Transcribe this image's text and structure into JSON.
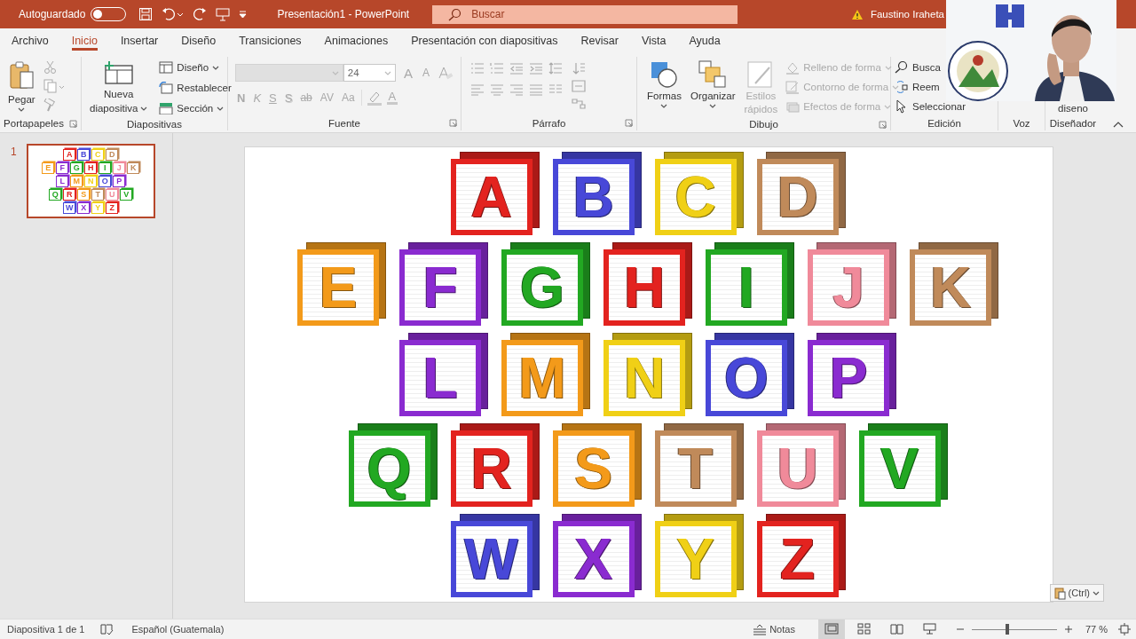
{
  "title_bar": {
    "autosave": {
      "label": "Autoguardado",
      "on": false
    },
    "title": "Presentación1  -  PowerPoint",
    "search": {
      "placeholder": "Buscar"
    },
    "user": "Faustino Iraheta"
  },
  "tabs": [
    {
      "label": "Archivo",
      "selected": false
    },
    {
      "label": "Inicio",
      "selected": true
    },
    {
      "label": "Insertar",
      "selected": false
    },
    {
      "label": "Diseño",
      "selected": false
    },
    {
      "label": "Transiciones",
      "selected": false
    },
    {
      "label": "Animaciones",
      "selected": false
    },
    {
      "label": "Presentación con diapositivas",
      "selected": false
    },
    {
      "label": "Revisar",
      "selected": false
    },
    {
      "label": "Vista",
      "selected": false
    },
    {
      "label": "Ayuda",
      "selected": false
    }
  ],
  "ribbon": {
    "clipboard": {
      "paste": "Pegar",
      "label": "Portapapeles"
    },
    "slides": {
      "new_slide": [
        "Nueva",
        "diapositiva"
      ],
      "items": [
        {
          "label": "Diseño",
          "kind": "layout"
        },
        {
          "label": "Restablecer",
          "kind": "reset"
        },
        {
          "label": "Sección",
          "kind": "section"
        }
      ],
      "label": "Diapositivas"
    },
    "font": {
      "disabled": true,
      "size": "24",
      "row1": [
        {
          "text": "A",
          "kind": "grow"
        },
        {
          "text": "A",
          "kind": "shrink"
        }
      ],
      "row2": [
        {
          "text": "N",
          "kind": "bold"
        },
        {
          "text": "K",
          "kind": "italic"
        },
        {
          "text": "S",
          "kind": "underline"
        },
        {
          "text": "S",
          "kind": "shadow"
        },
        {
          "text": "ab",
          "kind": "strike"
        },
        {
          "text": "AV",
          "kind": "spacing"
        },
        {
          "text": "Aa",
          "kind": "case"
        },
        {
          "text": "A",
          "kind": "color"
        }
      ],
      "label": "Fuente"
    },
    "paragraph": {
      "disabled": true,
      "label": "Párrafo"
    },
    "drawing": {
      "shapes": "Formas",
      "arrange": "Organizar",
      "quick_styles": {
        "label": "Estilos rápidos",
        "disabled": true
      },
      "format_items": [
        {
          "label": "Relleno de forma",
          "kind": "fill",
          "disabled": true
        },
        {
          "label": "Contorno de forma",
          "kind": "outline",
          "disabled": true
        },
        {
          "label": "Efectos de forma",
          "kind": "effects",
          "disabled": true
        }
      ],
      "label": "Dibujo"
    },
    "editing": {
      "items": [
        {
          "label": "Busca",
          "kind": "find"
        },
        {
          "label": "Reem",
          "kind": "replace"
        },
        {
          "label": "Seleccionar",
          "kind": "select"
        }
      ],
      "label": "Edición"
    },
    "voice": {
      "label": "Voz"
    },
    "designer": {
      "button": "diseno",
      "label": "Diseñador"
    }
  },
  "thumbnails": [
    {
      "number": "1",
      "selected": true,
      "rows": [
        [
          "A",
          "B",
          "C",
          "D"
        ],
        [
          "E",
          "F",
          "G",
          "H",
          "I",
          "J",
          "K"
        ],
        [
          "L",
          "M",
          "N",
          "O",
          "P"
        ],
        [
          "Q",
          "R",
          "S",
          "T",
          "U",
          "V"
        ],
        [
          "W",
          "X",
          "Y",
          "Z"
        ]
      ]
    }
  ],
  "slide": {
    "rows": [
      {
        "blocks": [
          {
            "letter": "A",
            "color": "#e3231f"
          },
          {
            "letter": "B",
            "color": "#4848d8"
          },
          {
            "letter": "C",
            "color": "#f0d016"
          },
          {
            "letter": "D",
            "color": "#c08a5a"
          }
        ]
      },
      {
        "blocks": [
          {
            "letter": "E",
            "color": "#f39a1a"
          },
          {
            "letter": "F",
            "color": "#8a2bd0"
          },
          {
            "letter": "G",
            "color": "#22a822"
          },
          {
            "letter": "H",
            "color": "#e3231f"
          },
          {
            "letter": "I",
            "color": "#22a822"
          },
          {
            "letter": "J",
            "color": "#f08a9a"
          },
          {
            "letter": "K",
            "color": "#c08a5a"
          }
        ]
      },
      {
        "blocks": [
          {
            "letter": "L",
            "color": "#8a2bd0"
          },
          {
            "letter": "M",
            "color": "#f39a1a"
          },
          {
            "letter": "N",
            "color": "#f0d016"
          },
          {
            "letter": "O",
            "color": "#4848d8"
          },
          {
            "letter": "P",
            "color": "#8a2bd0"
          }
        ]
      },
      {
        "blocks": [
          {
            "letter": "Q",
            "color": "#22a822"
          },
          {
            "letter": "R",
            "color": "#e3231f"
          },
          {
            "letter": "S",
            "color": "#f39a1a"
          },
          {
            "letter": "T",
            "color": "#c08a5a"
          },
          {
            "letter": "U",
            "color": "#f08a9a"
          },
          {
            "letter": "V",
            "color": "#22a822"
          }
        ]
      },
      {
        "blocks": [
          {
            "letter": "W",
            "color": "#4848d8"
          },
          {
            "letter": "X",
            "color": "#8a2bd0"
          },
          {
            "letter": "Y",
            "color": "#f0d016"
          },
          {
            "letter": "Z",
            "color": "#e3231f"
          }
        ]
      }
    ]
  },
  "paste_options": "(Ctrl)",
  "status_bar": {
    "slide_count": "Diapositiva 1 de 1",
    "language": "Español (Guatemala)",
    "notes": "Notas",
    "views": [
      {
        "kind": "normal",
        "selected": true
      },
      {
        "kind": "sorter",
        "selected": false
      },
      {
        "kind": "reading",
        "selected": false
      },
      {
        "kind": "show",
        "selected": false
      }
    ],
    "zoom": {
      "level": 0.42,
      "reading": "77 %"
    }
  }
}
